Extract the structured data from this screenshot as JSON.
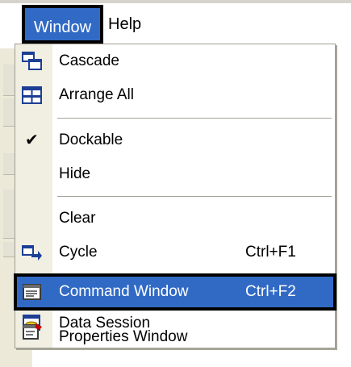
{
  "menubar": {
    "items": [
      {
        "label": "Window",
        "state": "open"
      },
      {
        "label": "Help",
        "state": "closed"
      }
    ]
  },
  "window_menu": {
    "items": [
      {
        "label": "Cascade",
        "shortcut": "",
        "icon": "cascade-windows-icon"
      },
      {
        "label": "Arrange All",
        "shortcut": "",
        "icon": "arrange-all-icon"
      },
      {
        "label": "Dockable",
        "shortcut": "",
        "checked": true,
        "icon": "checkmark-icon"
      },
      {
        "label": "Hide",
        "shortcut": ""
      },
      {
        "label": "Clear",
        "shortcut": ""
      },
      {
        "label": "Cycle",
        "shortcut": "Ctrl+F1",
        "icon": "cycle-windows-icon"
      },
      {
        "label": "Command Window",
        "shortcut": "Ctrl+F2",
        "icon": "command-window-icon",
        "highlighted": true
      },
      {
        "label": "Data Session",
        "shortcut": "",
        "icon": "data-session-icon"
      },
      {
        "label": "Properties Window",
        "shortcut": "",
        "icon": "properties-window-icon"
      }
    ]
  },
  "colors": {
    "highlight": "#316ac5",
    "icon_column": "#f1efe2",
    "menu_text": "#000000",
    "highlight_text": "#ffffff",
    "annotation_border": "#000000"
  }
}
